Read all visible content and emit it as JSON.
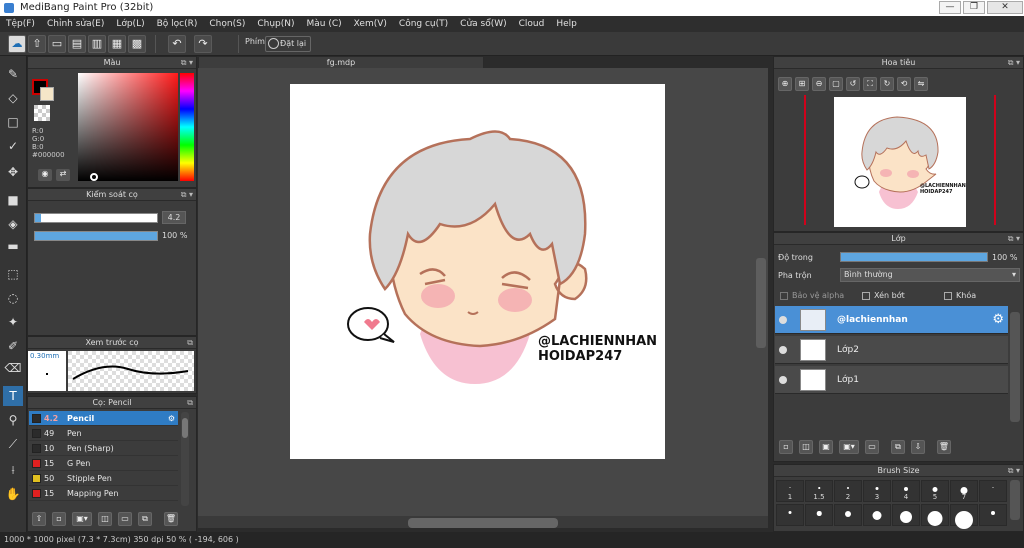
{
  "window": {
    "title": "MediBang Paint Pro (32bit)",
    "min": "—",
    "max": "❐",
    "close": "✕"
  },
  "menu": [
    "Tệp(F)",
    "Chỉnh sửa(E)",
    "Lớp(L)",
    "Bộ lọc(R)",
    "Chọn(S)",
    "Chụp(N)",
    "Màu (C)",
    "Xem(V)",
    "Công cụ(T)",
    "Cửa sổ(W)",
    "Cloud",
    "Help"
  ],
  "toolbar": {
    "antialias_label": "Phím",
    "reset_label": "Đặt lại"
  },
  "panels": {
    "color": "Màu",
    "brush_control": "Kiểm soát cọ",
    "brush_preview": "Xem trước cọ",
    "brush_list": "Cọ: Pencil",
    "navigator": "Hoa tiêu",
    "layer": "Lớp",
    "brush_size": "Brush Size"
  },
  "color": {
    "r": "R:0",
    "g": "G:0",
    "b": "B:0",
    "hex": "#000000",
    "primary": "#000000",
    "secondary": "#f5e6c8",
    "accent": "#c00000"
  },
  "brush_control": {
    "size_value": "4.2",
    "size_fill": 0.05,
    "opacity_value": "100 %",
    "opacity_fill": 1.0
  },
  "brush_preview": {
    "size": "0.30mm"
  },
  "brushes": [
    {
      "size": "4.2",
      "name": "Pencil",
      "color": "#2b2b2b",
      "selected": true
    },
    {
      "size": "49",
      "name": "Pen",
      "color": "#2b2b2b",
      "selected": false
    },
    {
      "size": "10",
      "name": "Pen (Sharp)",
      "color": "#2b2b2b",
      "selected": false
    },
    {
      "size": "15",
      "name": "G Pen",
      "color": "#e02020",
      "selected": false
    },
    {
      "size": "50",
      "name": "Stipple Pen",
      "color": "#e0c020",
      "selected": false
    },
    {
      "size": "15",
      "name": "Mapping Pen",
      "color": "#e02020",
      "selected": false
    }
  ],
  "document": {
    "tab": "fg.mdp",
    "watermark_line1": "@LACHIENNHAN",
    "watermark_line2": "HOIDAP247",
    "nav_line1": "@LACHIENNHAN",
    "nav_line2": "HOIDAP247"
  },
  "layer_panel": {
    "opacity_label": "Độ trong",
    "opacity_value": "100 %",
    "blend_label": "Pha trộn",
    "blend_value": "Bình thường",
    "protect_alpha": "Bảo vệ alpha",
    "clipping": "Xén bớt",
    "lock": "Khóa",
    "layers": [
      {
        "name": "@lachiennhan",
        "selected": true
      },
      {
        "name": "Lớp2",
        "selected": false
      },
      {
        "name": "Lớp1",
        "selected": false
      }
    ]
  },
  "brush_sizes": [
    "1",
    "1.5",
    "2",
    "3",
    "4",
    "5",
    "7"
  ],
  "status": {
    "text": "1000 * 1000 pixel   (7.3 * 7.3cm)   350 dpi   50 %   ( -194, 606 )"
  }
}
